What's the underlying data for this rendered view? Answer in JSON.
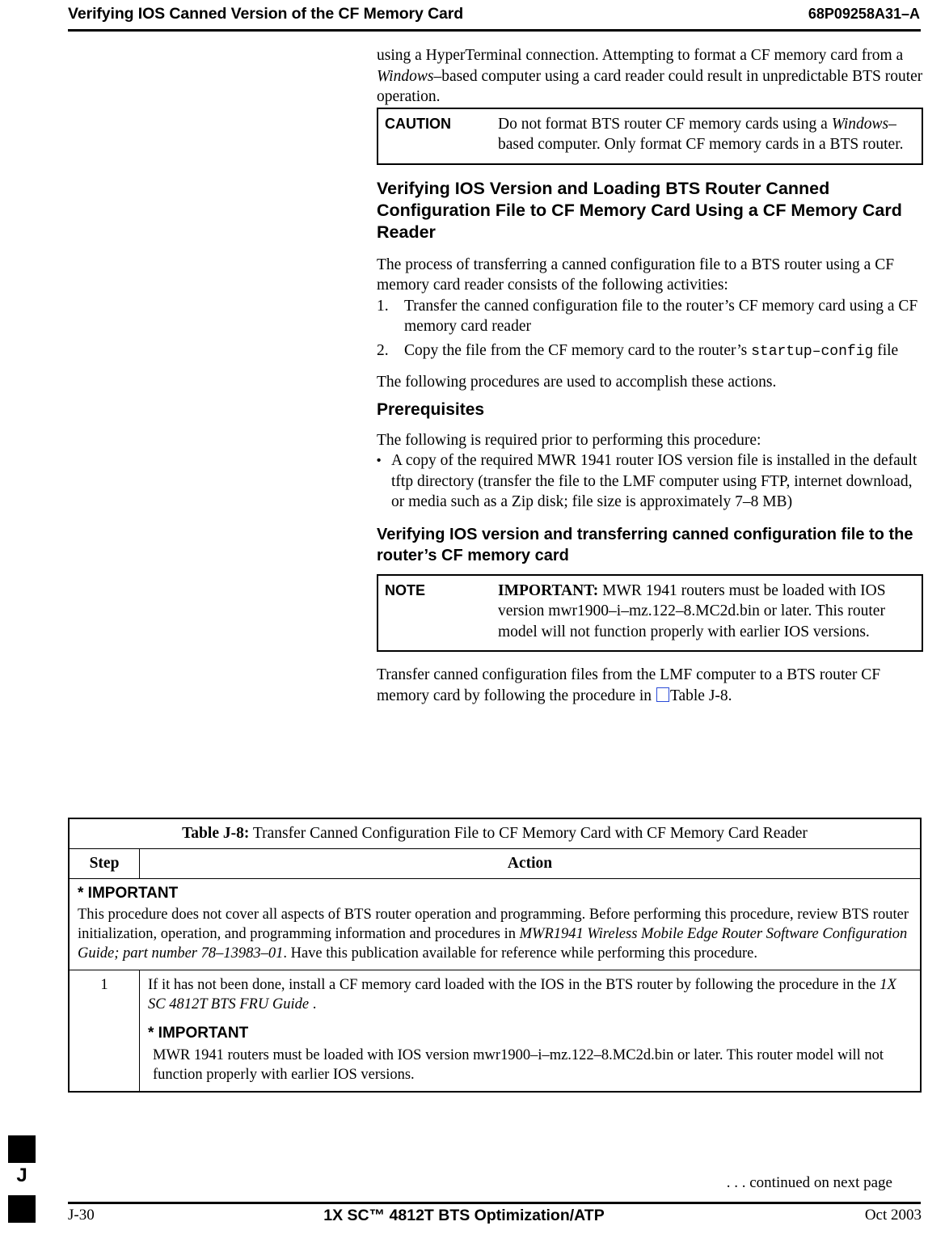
{
  "header": {
    "title": "Verifying IOS Canned Version of the CF Memory Card",
    "doc_number": "68P09258A31–A"
  },
  "body": {
    "intro": "using a HyperTerminal connection. Attempting to format a CF memory card from a ",
    "intro_italic": "Windows",
    "intro_cont": "–based computer using a card reader could result in unpredictable BTS router operation.",
    "caution": {
      "label": "CAUTION",
      "text_1": "Do not format BTS router CF memory cards using a ",
      "text_italic": "Windows",
      "text_2": "–based computer. Only format CF memory cards in a BTS router."
    },
    "section_heading": "Verifying IOS Version and Loading BTS Router Canned Configuration File to CF Memory Card Using a CF Memory Card Reader",
    "process_para": "The process of transferring a canned configuration file to a BTS router using a CF memory card reader consists of the following activities:",
    "steps": [
      {
        "num": "1.",
        "text": "Transfer the canned configuration file to the router’s CF memory card using a CF memory card reader"
      },
      {
        "num": "2.",
        "text_pre": "Copy the file from the CF memory card to the router’s ",
        "mono": "startup–config",
        "text_post": " file"
      }
    ],
    "following_para": "The following procedures are used to accomplish these actions.",
    "prereq_heading": "Prerequisites",
    "prereq_para": "The following is required prior to performing this procedure:",
    "prereq_bullet": "A copy of the required MWR 1941 router IOS version file is installed in the default tftp directory (transfer the file to the LMF computer using FTP, internet download, or media such as a Zip disk; file size is approximately 7–8 MB)",
    "verify_heading": "Verifying IOS version and transferring canned configuration file to the router’s CF memory card",
    "note": {
      "label": "NOTE",
      "bold_lead": "IMPORTANT:",
      "text": " MWR 1941 routers must be loaded with IOS version mwr1900–i–mz.122–8.MC2d.bin or later. This router model will not function properly with earlier IOS versions."
    },
    "transfer_para_1": "Transfer canned configuration files from the LMF computer to a BTS router CF memory card by following the procedure in",
    "transfer_para_2": "Table J-8."
  },
  "table": {
    "caption_bold": "Table J-8:",
    "caption_text": " Transfer Canned Configuration File to CF Memory Card with CF Memory Card Reader",
    "col_step": "Step",
    "col_action": "Action",
    "important_label": "* IMPORTANT",
    "important_text_1": "This procedure does not cover all aspects of BTS router operation and programming. Before performing this procedure, review BTS router initialization, operation, and programming information and procedures in ",
    "important_italic": "MWR1941 Wireless Mobile Edge Router Software Configuration Guide; part number 78–13983–01",
    "important_text_2": ". Have this publication available for reference while performing this procedure.",
    "rows": [
      {
        "step": "1",
        "text_1": "If it has not been done, install a CF memory card loaded with the IOS in the BTS router by following the procedure in the ",
        "italic": "1X SC 4812T BTS FRU Guide",
        "text_2": " .",
        "important_label": "* IMPORTANT",
        "important_body": "MWR 1941 routers must be loaded with IOS version mwr1900–i–mz.122–8.MC2d.bin or later. This router model will not function properly with earlier IOS versions."
      }
    ],
    "continued": ". . . continued on next page"
  },
  "footer": {
    "page": "J-30",
    "center": "1X SC™ 4812T BTS Optimization/ATP",
    "date": "Oct 2003",
    "tab_letter": "J"
  }
}
